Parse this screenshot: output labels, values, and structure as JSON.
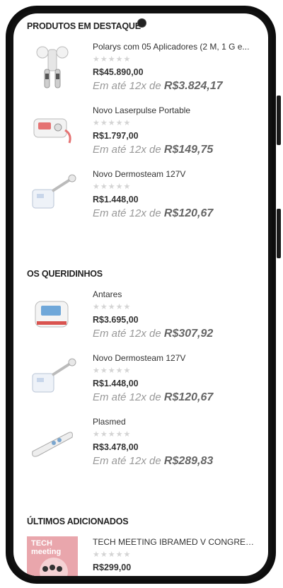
{
  "sections": [
    {
      "title": "PRODUTOS EM DESTAQUE",
      "products": [
        {
          "name": "Polarys com 05 Aplicadores (2 M, 1 G e...",
          "stars": "★★★★★",
          "price": "R$45.890,00",
          "installment_prefix": "Em até 12x de",
          "installment_value": "R$3.824,17",
          "thumb": "polarys-device"
        },
        {
          "name": "Novo Laserpulse Portable",
          "stars": "★★★★★",
          "price": "R$1.797,00",
          "installment_prefix": "Em até 12x de",
          "installment_value": "R$149,75",
          "thumb": "laserpulse-device"
        },
        {
          "name": "Novo Dermosteam 127V",
          "stars": "★★★★★",
          "price": "R$1.448,00",
          "installment_prefix": "Em até 12x de",
          "installment_value": "R$120,67",
          "thumb": "dermosteam-device"
        }
      ]
    },
    {
      "title": "OS QUERIDINHOS",
      "products": [
        {
          "name": "Antares",
          "stars": "★★★★★",
          "price": "R$3.695,00",
          "installment_prefix": "Em até 12x de",
          "installment_value": "R$307,92",
          "thumb": "antares-device"
        },
        {
          "name": "Novo Dermosteam 127V",
          "stars": "★★★★★",
          "price": "R$1.448,00",
          "installment_prefix": "Em até 12x de",
          "installment_value": "R$120,67",
          "thumb": "dermosteam-device"
        },
        {
          "name": "Plasmed",
          "stars": "★★★★★",
          "price": "R$3.478,00",
          "installment_prefix": "Em até 12x de",
          "installment_value": "R$289,83",
          "thumb": "plasmed-device"
        }
      ]
    },
    {
      "title": "ÚLTIMOS ADICIONADOS",
      "products": [
        {
          "name": "TECH MEETING IBRAMED V CONGRESSO ...",
          "stars": "★★★★★",
          "price": "R$299,00",
          "installment_prefix": "",
          "installment_value": "",
          "thumb": "tech-meeting-banner",
          "banner_text": "TECH meeting"
        }
      ]
    }
  ]
}
